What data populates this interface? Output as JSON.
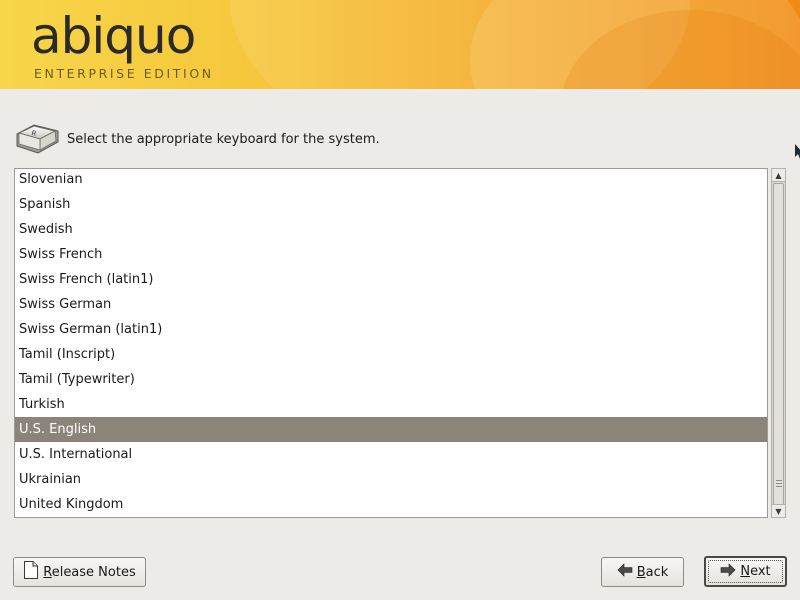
{
  "banner": {
    "logo_word": "abiquo",
    "logo_subtitle": "ENTERPRISE EDITION"
  },
  "prompt": {
    "icon": "keyboard-key-icon",
    "text": "Select the appropriate keyboard for the system."
  },
  "keyboard_list": {
    "items": [
      "Slovenian",
      "Spanish",
      "Swedish",
      "Swiss French",
      "Swiss French (latin1)",
      "Swiss German",
      "Swiss German (latin1)",
      "Tamil (Inscript)",
      "Tamil (Typewriter)",
      "Turkish",
      "U.S. English",
      "U.S. International",
      "Ukrainian",
      "United Kingdom"
    ],
    "selected": "U.S. English",
    "selected_color": "#8b8479"
  },
  "buttons": {
    "release_notes": {
      "label_first": "R",
      "label_rest": "elease Notes",
      "icon": "document-icon"
    },
    "back": {
      "label_first": "B",
      "label_rest": "ack",
      "icon": "arrow-left-icon"
    },
    "next": {
      "label_first": "N",
      "label_rest": "ext",
      "icon": "arrow-right-icon"
    }
  },
  "colors": {
    "banner_start": "#f7d64a",
    "banner_end": "#f08a14",
    "accent_orange": "#ee7a16",
    "background": "#edebe7"
  }
}
